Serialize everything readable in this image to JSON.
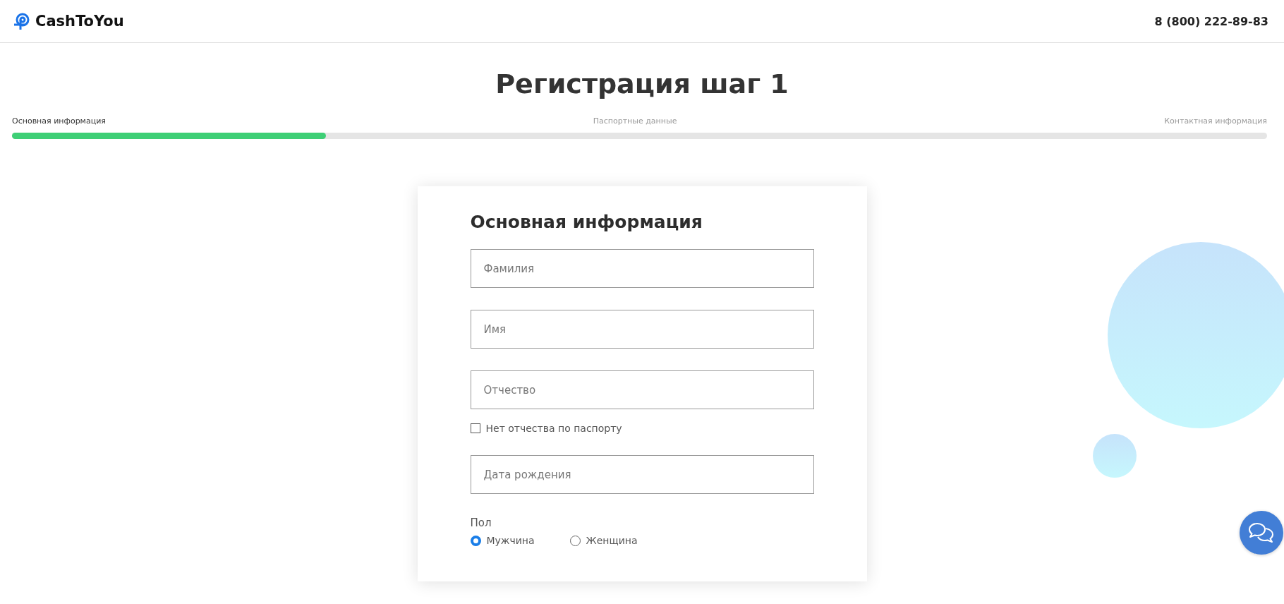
{
  "header": {
    "logo": "CashToYou",
    "phone": "8 (800) 222-89-83"
  },
  "page_title": "Регистрация шаг 1",
  "steps": [
    {
      "label": "Основная информация",
      "selected": true
    },
    {
      "label": "Паспортные данные",
      "selected": false
    },
    {
      "label": "Контактная информация",
      "selected": false
    }
  ],
  "progress": {
    "level": 0.25
  },
  "form": {
    "title": "Основная информация",
    "fields": [
      {
        "kind": "input",
        "placeholder": "Фамилия"
      },
      {
        "kind": "input",
        "placeholder": "Имя"
      },
      {
        "kind": "input",
        "placeholder": "Отчество"
      },
      {
        "kind": "checkbox",
        "label": "Нет отчества по паспорту",
        "checked": false
      },
      {
        "kind": "input",
        "placeholder": "Дата рождения"
      },
      {
        "kind": "radio",
        "label": "Пол",
        "options": [
          {
            "label": "Мужчина",
            "selected": true
          },
          {
            "label": "Женщина",
            "selected": false
          }
        ]
      }
    ]
  }
}
